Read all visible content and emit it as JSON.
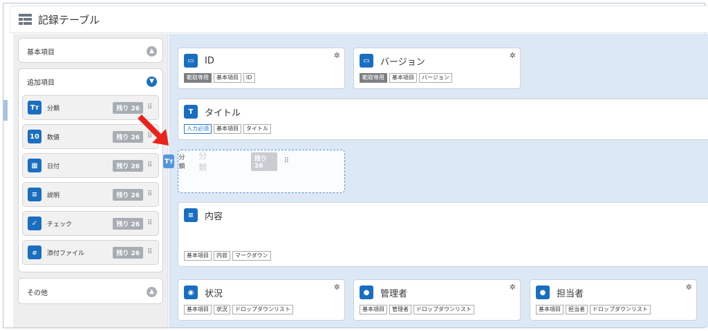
{
  "header": {
    "title": "記録テーブル",
    "icon": "table-icon"
  },
  "sidebar": {
    "basic": {
      "label": "基本項目",
      "toggle": "^"
    },
    "additional": {
      "label": "追加項目",
      "toggle": "v",
      "items": [
        {
          "label": "分類",
          "icon_text": "Tт",
          "icon": "text-type-icon",
          "remaining": "残り 26"
        },
        {
          "label": "数値",
          "icon_text": "10",
          "icon": "number-icon",
          "remaining": "残り 26"
        },
        {
          "label": "日付",
          "icon_text": "▦",
          "icon": "calendar-icon",
          "remaining": "残り 26"
        },
        {
          "label": "説明",
          "icon_text": "≡",
          "icon": "description-icon",
          "remaining": "残り 26"
        },
        {
          "label": "チェック",
          "icon_text": "✓",
          "icon": "check-icon",
          "remaining": "残り 26"
        },
        {
          "label": "添付ファイル",
          "icon_text": "⌀",
          "icon": "attachment-icon",
          "remaining": "残り 26"
        }
      ]
    },
    "other": {
      "label": "その他",
      "toggle": "^"
    }
  },
  "cards": {
    "id": {
      "title": "ID",
      "icon_text": "▭",
      "tags": [
        "範取専用",
        "基本項目",
        "ID"
      ]
    },
    "version": {
      "title": "バージョン",
      "icon_text": "▭",
      "tags": [
        "範取専用",
        "基本項目",
        "バージョン"
      ]
    },
    "title": {
      "title": "タイトル",
      "icon_text": "T",
      "tags": [
        "入力必須",
        "基本項目",
        "タイトル"
      ]
    },
    "content": {
      "title": "内容",
      "icon_text": "≡",
      "tags": [
        "基本項目",
        "内容",
        "マークダウン"
      ]
    },
    "status": {
      "title": "状況",
      "icon_text": "◉",
      "tags": [
        "基本項目",
        "状況",
        "ドロップダウンリスト"
      ]
    },
    "manager": {
      "title": "管理者",
      "icon_text": "●",
      "tags": [
        "基本項目",
        "管理者",
        "ドロップダウンリスト"
      ]
    },
    "owner": {
      "title": "担当者",
      "icon_text": "●",
      "tags": [
        "基本項目",
        "担当者",
        "ドロップダウンリスト"
      ]
    }
  },
  "drag": {
    "label": "分類",
    "faded_label": "分類",
    "icon_text": "Tт",
    "remaining": "残り 26"
  },
  "colors": {
    "accent": "#1a6ec0",
    "canvas": "#dce8f6",
    "arrow": "#e8231a"
  }
}
